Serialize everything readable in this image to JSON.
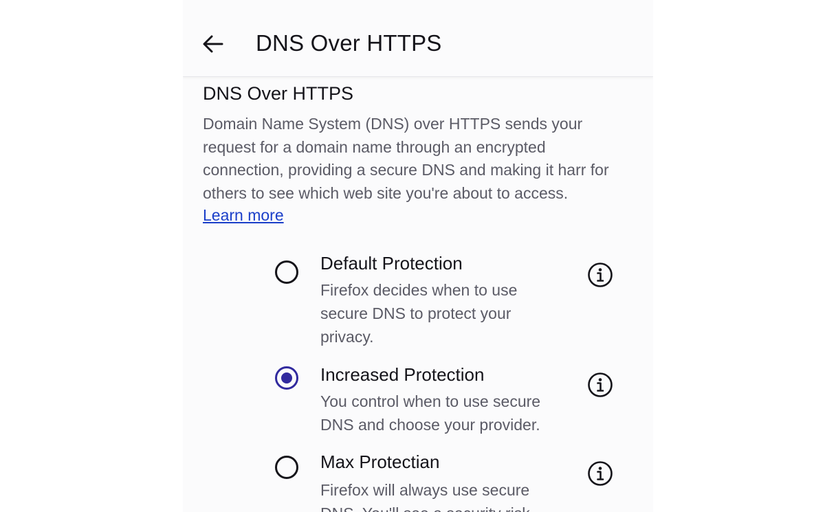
{
  "toolbar": {
    "back_icon": "arrow-left-icon",
    "title": "DNS Over HTTPS"
  },
  "section": {
    "title": "DNS Over HTTPS",
    "description": "Domain Name System (DNS) over HTTPS sends your request for a domain name through an encrypted connection, providing a secure DNS and making it harr for others to see which web site you're about to access.",
    "learn_more": "Learn more"
  },
  "options": [
    {
      "title": "Default Protection",
      "description": "Firefox decides when to use secure DNS to protect your privacy.",
      "selected": false
    },
    {
      "title": "Increased Protection",
      "description": "You control when to use secure DNS and choose your provider.",
      "selected": true
    },
    {
      "title": "Max Protectian",
      "description": "Firefox will always use secure DNS. You'll see a security risk",
      "selected": false
    }
  ],
  "colors": {
    "accent": "#312a9e",
    "link": "#1b3fc9",
    "text_primary": "#15141a",
    "text_secondary": "#5b5b66"
  }
}
